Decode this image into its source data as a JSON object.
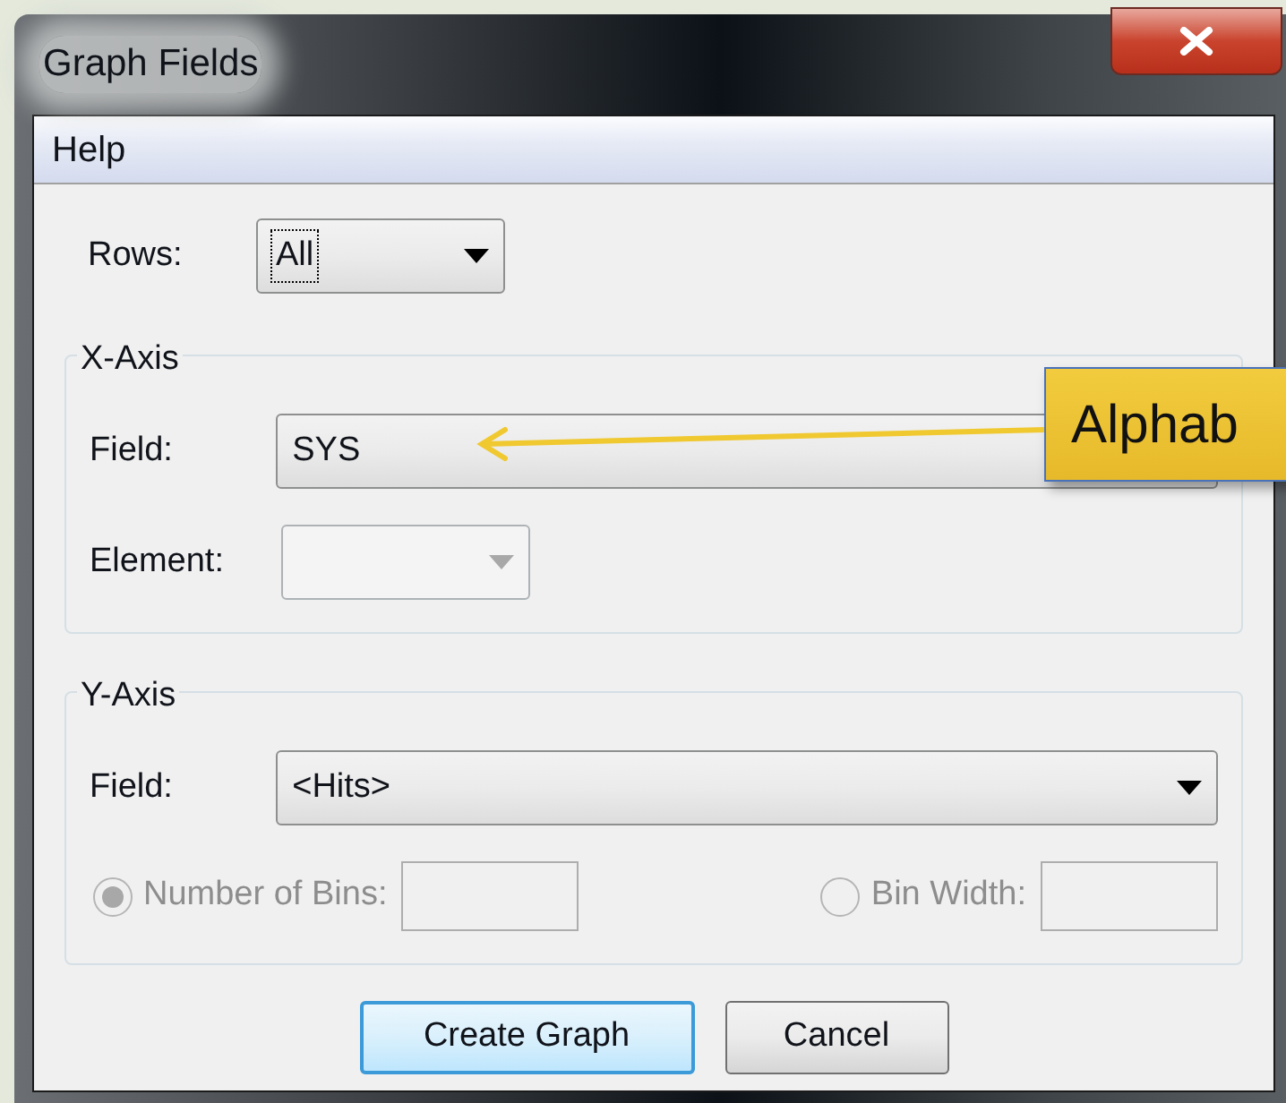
{
  "window": {
    "title": "Graph Fields"
  },
  "menu": [
    {
      "label": "Help"
    }
  ],
  "rows": {
    "label": "Rows:",
    "value": "All",
    "focused": true
  },
  "x_axis": {
    "title": "X-Axis",
    "field": {
      "label": "Field:",
      "value": "SYS",
      "disabled": false
    },
    "element": {
      "label": "Element:",
      "disabled": true
    }
  },
  "y_axis": {
    "title": "Y-Axis",
    "field": {
      "label": "Field:",
      "value": "<Hits>",
      "disabled": false
    },
    "bins": [
      {
        "label": "Number of Bins:",
        "selected": true,
        "disabled": true
      },
      {
        "label": "Bin Width:",
        "selected": false,
        "disabled": true
      }
    ]
  },
  "buttons": [
    {
      "label": "Create Graph",
      "default": true
    },
    {
      "label": "Cancel",
      "default": false
    }
  ],
  "callout": {
    "text": "Alphab"
  }
}
